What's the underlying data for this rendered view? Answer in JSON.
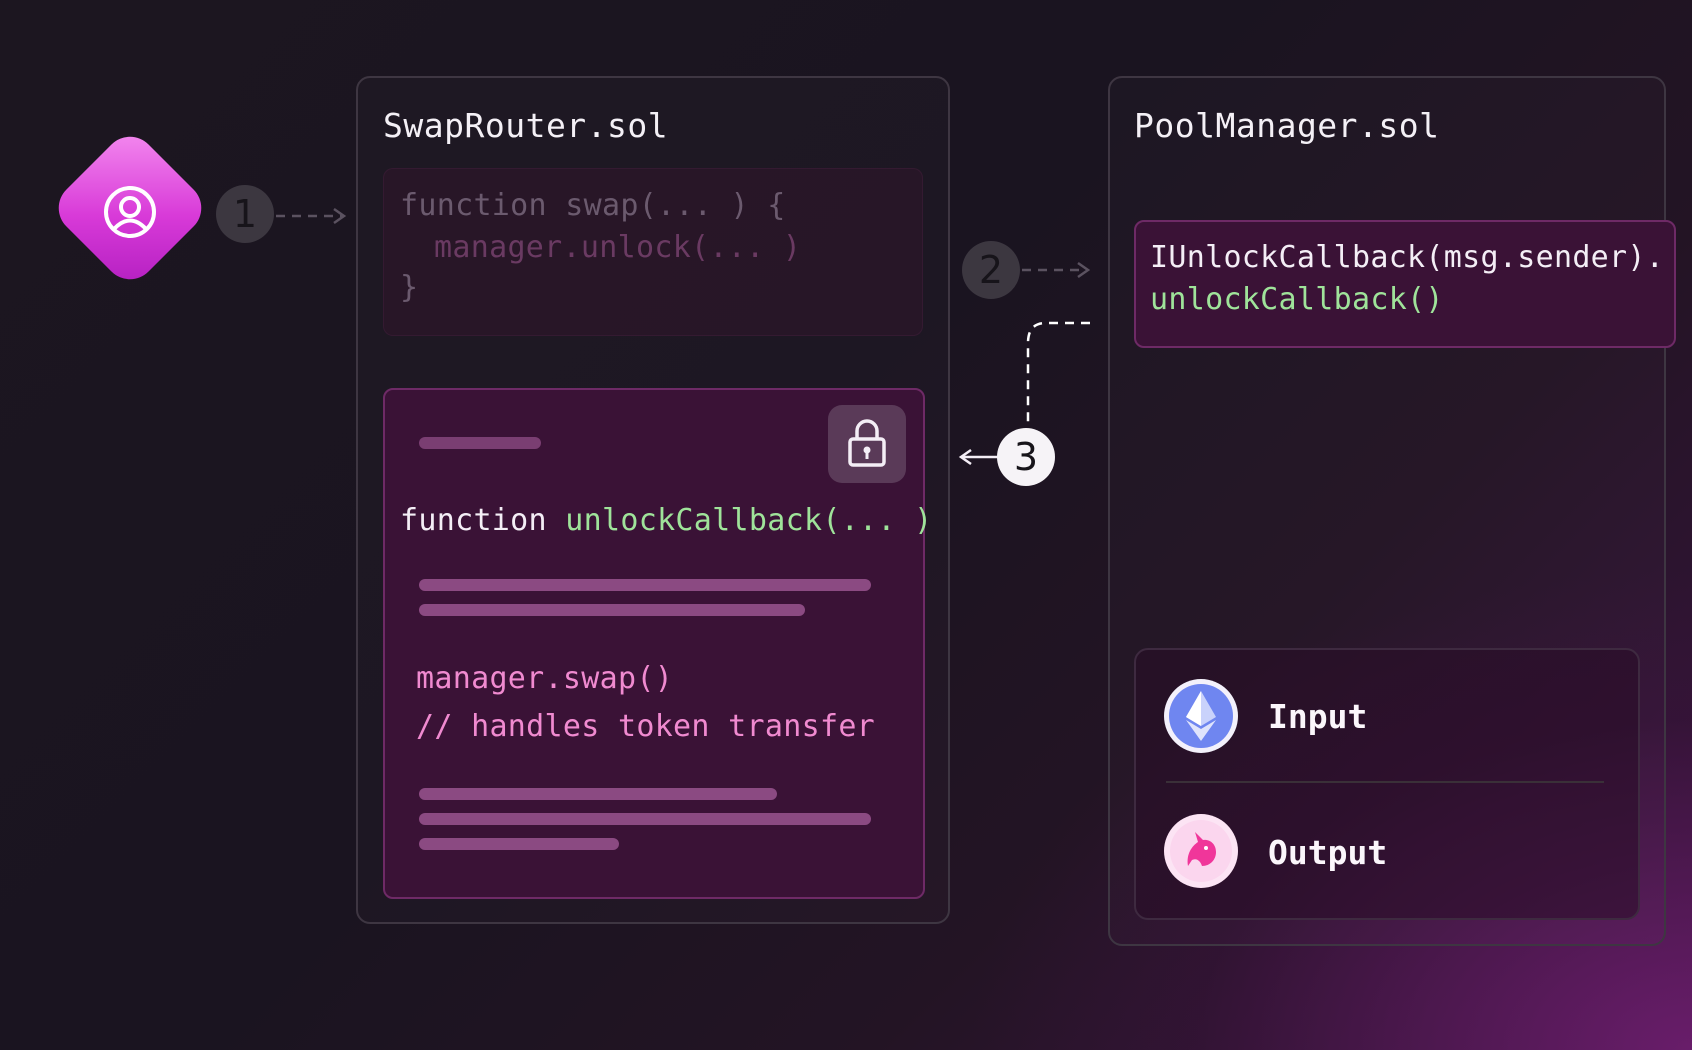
{
  "steps": [
    "1",
    "2",
    "3"
  ],
  "swap_router": {
    "title": "SwapRouter.sol",
    "swap_fn_line1": "function swap(... ) {",
    "swap_fn_line2": "manager.unlock(... )",
    "swap_fn_line3": "}",
    "callback_keyword": "function ",
    "callback_name": "unlockCallback(... )",
    "swap_call": "manager.swap()",
    "comment": "// handles token transfer"
  },
  "pool_manager": {
    "title": "PoolManager.sol",
    "callback_line1": "IUnlockCallback(msg.sender).",
    "callback_line2": "unlockCallback()",
    "tokens": [
      {
        "label": "Input",
        "icon": "ethereum-icon"
      },
      {
        "label": "Output",
        "icon": "uniswap-unicorn-icon"
      }
    ]
  },
  "colors": {
    "accent_pink": "#e040c8",
    "code_green": "#9fe39a",
    "code_pink": "#f08ad0",
    "eth_blue": "#6f86f0"
  }
}
